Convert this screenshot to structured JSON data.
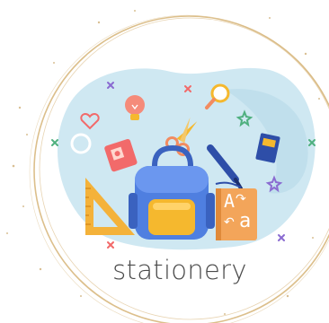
{
  "caption": "stationery",
  "book_letters": {
    "top": "A",
    "bottom": "a"
  },
  "colors": {
    "blob": "#cfe8f2",
    "ring": "#d8b87e",
    "backpack": "#4f7fe0",
    "backpack_pocket": "#f5b82e",
    "book": "#f3a55a",
    "ruler": "#f4b23a",
    "sharpener": "#f26a6a",
    "pen": "#2e4ea8"
  },
  "icons": [
    "backpack-icon",
    "book-icon",
    "ruler-triangle-icon",
    "sharpener-icon",
    "scissors-icon",
    "pen-icon",
    "lightbulb-icon",
    "magnifier-icon",
    "notebook-icon",
    "heart-icon",
    "star-icon",
    "cross-sparkle-icon"
  ]
}
